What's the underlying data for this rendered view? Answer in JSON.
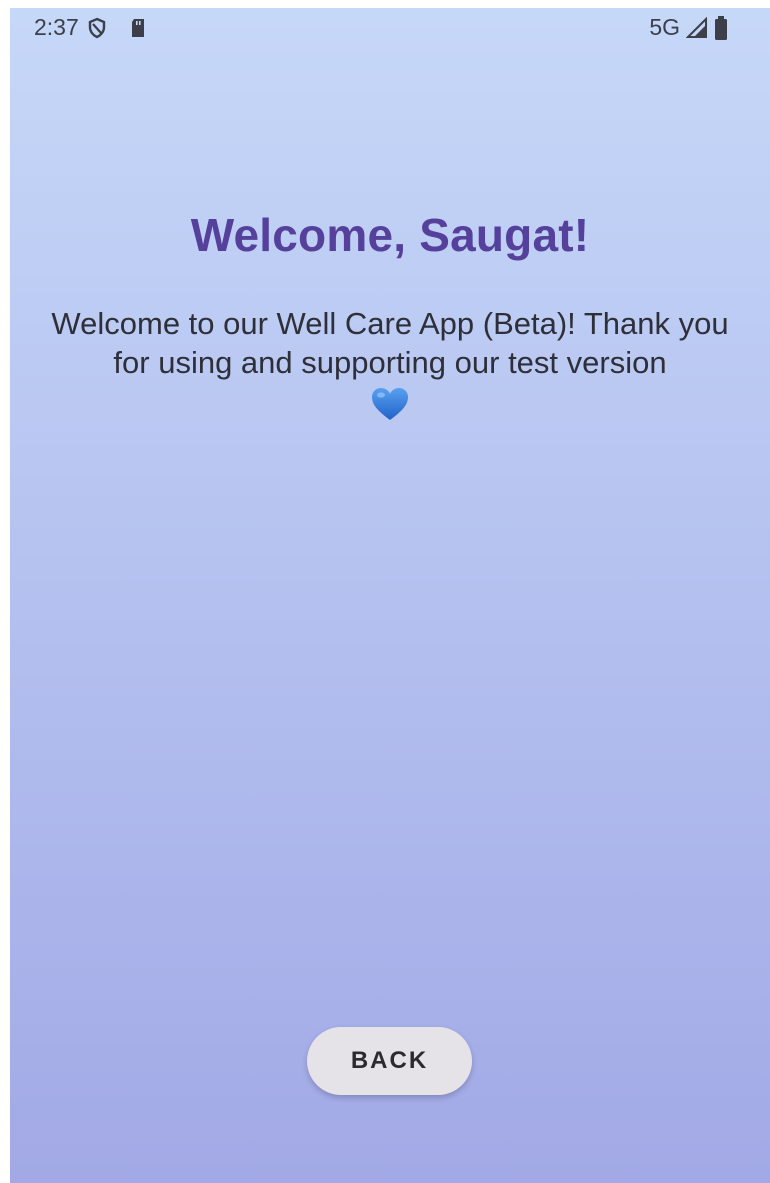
{
  "status_bar": {
    "time": "2:37",
    "network": "5G",
    "icons": [
      "shield-icon",
      "sd-card-icon",
      "signal-icon",
      "battery-icon"
    ]
  },
  "welcome": {
    "title": "Welcome, Saugat!",
    "message": "Welcome to our Well Care App (Beta)! Thank you for using and supporting our test version",
    "emoji_icon": "blue-heart-icon"
  },
  "actions": {
    "back_label": "BACK"
  },
  "colors": {
    "title": "#55409c",
    "background_top": "#c6d8f8",
    "background_bottom": "#a2a9e6",
    "button_bg": "#e6e3e8",
    "heart": "#2f7fe0"
  }
}
